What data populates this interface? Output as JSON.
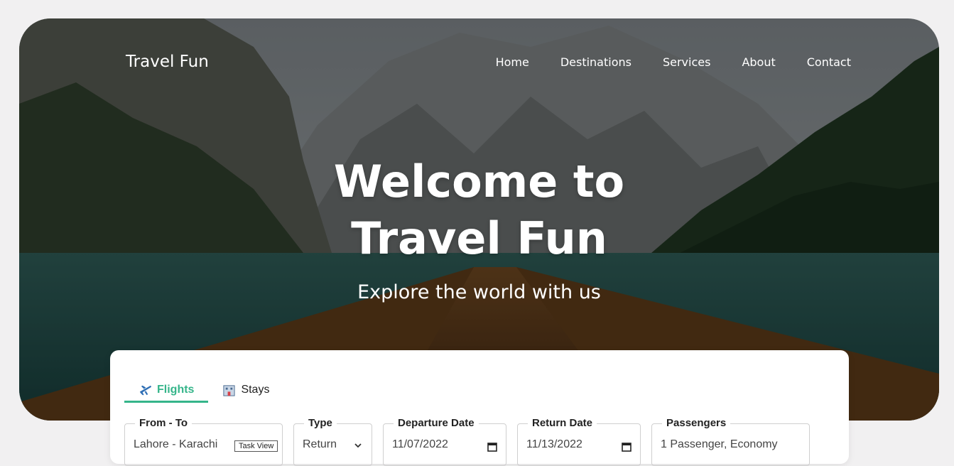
{
  "header": {
    "brand": "Travel Fun",
    "nav": [
      "Home",
      "Destinations",
      "Services",
      "About",
      "Contact"
    ]
  },
  "hero": {
    "title_line1": "Welcome to",
    "title_line2": "Travel Fun",
    "subtitle": "Explore the world with us"
  },
  "search": {
    "tabs": [
      {
        "label": "Flights",
        "icon": "airplane-icon"
      },
      {
        "label": "Stays",
        "icon": "hotel-icon"
      }
    ],
    "fields": [
      {
        "label": "From - To",
        "value": "Lahore - Karachi"
      },
      {
        "label": "Type",
        "value": "Return"
      },
      {
        "label": "Departure Date",
        "value": "11/07/2022"
      },
      {
        "label": "Return Date",
        "value": "11/13/2022"
      },
      {
        "label": "Passengers",
        "value": "1 Passenger, Economy"
      }
    ],
    "tooltip": "Task View"
  },
  "colors": {
    "accent": "#35b58a",
    "background": "#f1f0f1"
  }
}
